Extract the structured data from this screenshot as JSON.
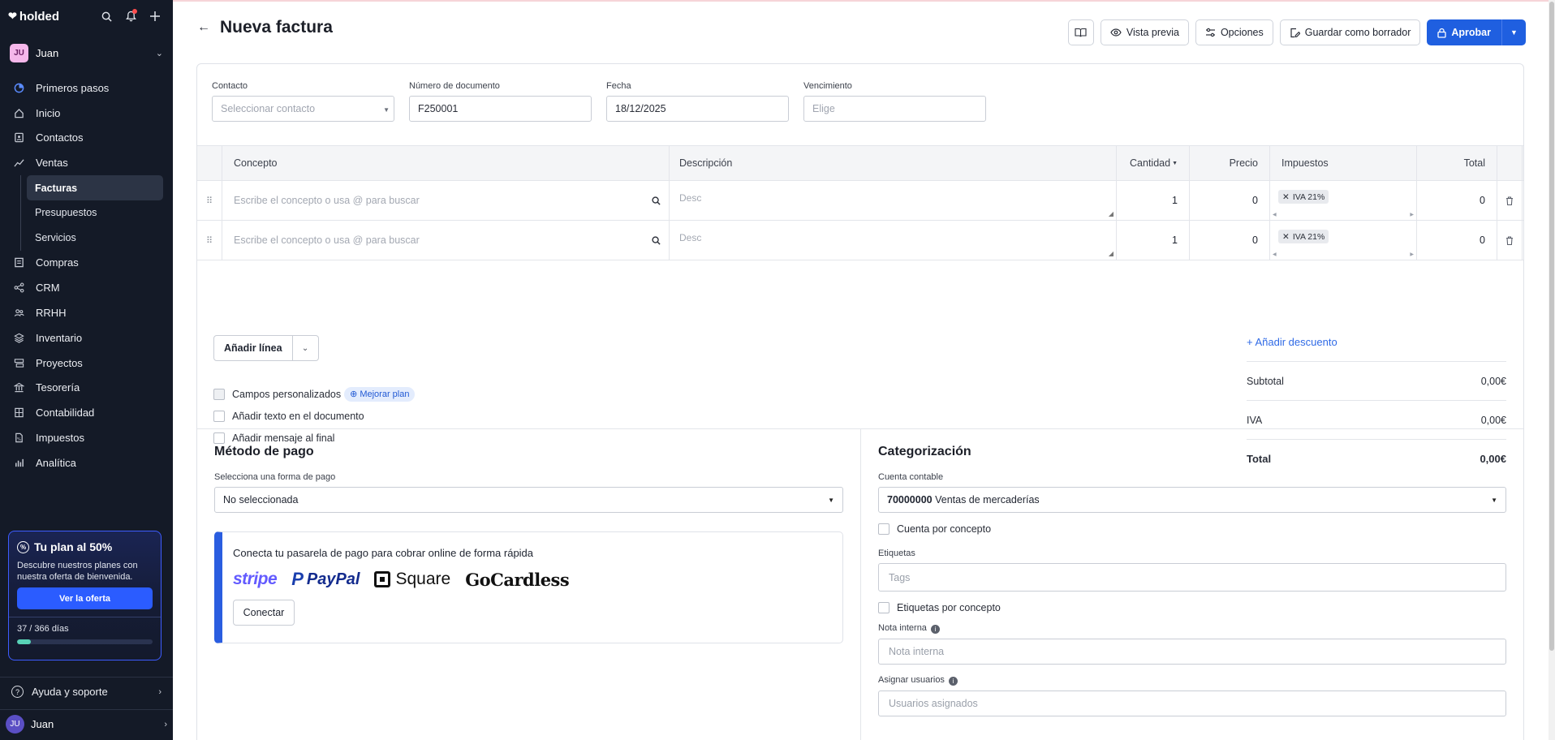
{
  "sidebar": {
    "logo": "holded",
    "user_initials": "JU",
    "user_name": "Juan",
    "nav": [
      {
        "label": "Primeros pasos",
        "icon": "progress-icon"
      },
      {
        "label": "Inicio",
        "icon": "home-icon"
      },
      {
        "label": "Contactos",
        "icon": "contacts-icon"
      },
      {
        "label": "Ventas",
        "icon": "sales-chart-icon"
      },
      {
        "label": "Compras",
        "icon": "purchases-icon"
      },
      {
        "label": "CRM",
        "icon": "crm-share-icon"
      },
      {
        "label": "RRHH",
        "icon": "people-icon"
      },
      {
        "label": "Inventario",
        "icon": "layers-icon"
      },
      {
        "label": "Proyectos",
        "icon": "projects-icon"
      },
      {
        "label": "Tesorería",
        "icon": "bank-icon"
      },
      {
        "label": "Contabilidad",
        "icon": "ledger-icon"
      },
      {
        "label": "Impuestos",
        "icon": "tax-doc-icon"
      },
      {
        "label": "Analítica",
        "icon": "analytics-icon"
      }
    ],
    "ventas_sub": [
      {
        "label": "Facturas",
        "active": true
      },
      {
        "label": "Presupuestos",
        "active": false
      },
      {
        "label": "Servicios",
        "active": false
      }
    ],
    "promo": {
      "title": "Tu plan al 50%",
      "text": "Descubre nuestros planes con nuestra oferta de bienvenida.",
      "button": "Ver la oferta",
      "days": "37 / 366 días",
      "progress": 0.101
    },
    "help": "Ayuda y soporte",
    "bottom_user_initials": "JU",
    "bottom_user": "Juan"
  },
  "header": {
    "title": "Nueva factura",
    "preview": "Vista previa",
    "options": "Opciones",
    "save_draft": "Guardar como borrador",
    "approve": "Aprobar"
  },
  "fields": {
    "contact_label": "Contacto",
    "contact_placeholder": "Seleccionar contacto",
    "doc_label": "Número de documento",
    "doc_value": "F250001",
    "date_label": "Fecha",
    "date_value": "18/12/2025",
    "due_label": "Vencimiento",
    "due_placeholder": "Elige"
  },
  "table": {
    "headers": {
      "concept": "Concepto",
      "description": "Descripción",
      "quantity": "Cantidad",
      "price": "Precio",
      "taxes": "Impuestos",
      "total": "Total"
    },
    "rows": [
      {
        "concept_placeholder": "Escribe el concepto o usa @ para buscar",
        "desc_placeholder": "Desc",
        "qty": "1",
        "price": "0",
        "tax": "IVA 21%",
        "total": "0"
      },
      {
        "concept_placeholder": "Escribe el concepto o usa @ para buscar",
        "desc_placeholder": "Desc",
        "qty": "1",
        "price": "0",
        "tax": "IVA 21%",
        "total": "0"
      }
    ]
  },
  "add_line": "Añadir línea",
  "options_list": {
    "custom_fields": "Campos personalizados",
    "upgrade": "Mejorar plan",
    "add_text": "Añadir texto en el documento",
    "add_message": "Añadir mensaje al final"
  },
  "totals": {
    "add_discount": "+ Añadir descuento",
    "subtotal_label": "Subtotal",
    "subtotal": "0,00€",
    "iva_label": "IVA",
    "iva": "0,00€",
    "total_label": "Total",
    "total": "0,00€"
  },
  "payment": {
    "title": "Método de pago",
    "select_label": "Selecciona una forma de pago",
    "select_value": "No seleccionada",
    "gateway_title": "Conecta tu pasarela de pago para cobrar online de forma rápida",
    "logos": [
      "stripe",
      "PayPal",
      "Square",
      "GoCardless"
    ],
    "connect": "Conectar"
  },
  "categorization": {
    "title": "Categorización",
    "account_label": "Cuenta contable",
    "account_code": "70000000",
    "account_name": "Ventas de mercaderías",
    "per_concept_account": "Cuenta por concepto",
    "tags_label": "Etiquetas",
    "tags_placeholder": "Tags",
    "per_concept_tags": "Etiquetas por concepto",
    "note_label": "Nota interna",
    "note_placeholder": "Nota interna",
    "assign_label": "Asignar usuarios",
    "assign_placeholder": "Usuarios asignados"
  },
  "colors": {
    "sidebar_bg": "#141a27",
    "primary": "#1f5fe0",
    "link": "#2f6ae6",
    "progress": "#58d2b6"
  }
}
